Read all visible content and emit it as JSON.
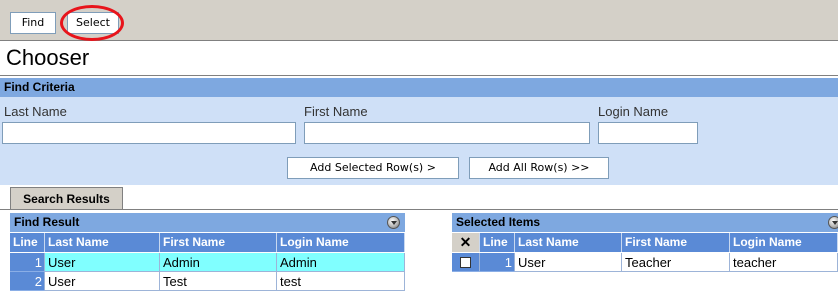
{
  "toolbar": {
    "find_label": "Find",
    "select_label": "Select"
  },
  "page": {
    "title": "Chooser"
  },
  "find_criteria": {
    "header": "Find Criteria",
    "last_name_label": "Last Name",
    "first_name_label": "First Name",
    "login_name_label": "Login Name",
    "last_name_value": "",
    "first_name_value": "",
    "login_name_value": "",
    "add_selected_label": "Add Selected Row(s) >",
    "add_all_label": "Add All Row(s) >>"
  },
  "tabs": [
    {
      "label": "Search Results",
      "active": true
    }
  ],
  "find_result": {
    "header": "Find Result",
    "columns": [
      "Line",
      "Last Name",
      "First Name",
      "Login Name"
    ],
    "rows": [
      {
        "line": "1",
        "last": "User",
        "first": "Admin",
        "login": "Admin",
        "selected": true
      },
      {
        "line": "2",
        "last": "User",
        "first": "Test",
        "login": "test",
        "selected": false
      }
    ]
  },
  "selected_items": {
    "header": "Selected Items",
    "select_all_glyph": "✕",
    "columns": [
      "Line",
      "Last Name",
      "First Name",
      "Login Name"
    ],
    "rows": [
      {
        "checked": false,
        "line": "1",
        "last": "User",
        "first": "Teacher",
        "login": "teacher"
      }
    ]
  },
  "colors": {
    "header_blue": "#7ea8e0",
    "column_header_blue": "#5a8ad6",
    "panel_blue": "#cfe0f7",
    "selected_row": "#80ffff",
    "highlight_ring": "#e8141b"
  }
}
